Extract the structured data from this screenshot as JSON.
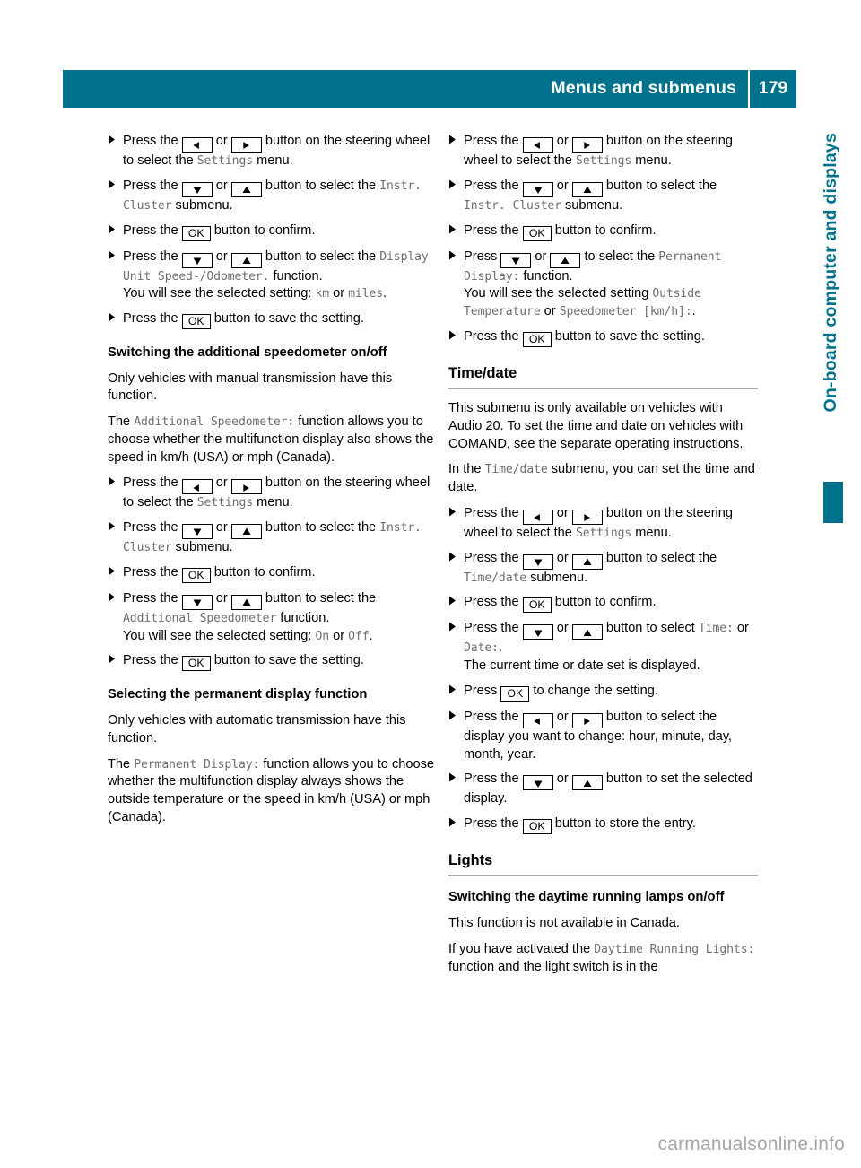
{
  "header": {
    "title": "Menus and submenus",
    "page_number": "179",
    "accent_color": "#00718b"
  },
  "side_tab": {
    "label": "On-board computer and displays",
    "color": "#00718b",
    "bookmark": "chapter-bookmark"
  },
  "watermark": {
    "text": "carmanualsonline.info",
    "color": "#a6a6a6"
  },
  "icons": {
    "bullet": "triangle-right-bullet-icon",
    "left": "arrow-left-icon",
    "right": "arrow-right-icon",
    "up": "arrow-up-icon",
    "down": "arrow-down-icon",
    "ok": "ok-key-icon"
  },
  "keys": {
    "ok_label": "OK"
  },
  "left_column": {
    "steps_display_unit": [
      {
        "parts": [
          {
            "t": "text",
            "v": "Press the "
          },
          {
            "t": "key",
            "v": "left"
          },
          {
            "t": "text",
            "v": " or "
          },
          {
            "t": "key",
            "v": "right"
          },
          {
            "t": "text",
            "v": " button on the steering wheel to select the "
          },
          {
            "t": "ui",
            "v": "Settings"
          },
          {
            "t": "text",
            "v": " menu."
          }
        ]
      },
      {
        "parts": [
          {
            "t": "text",
            "v": "Press the "
          },
          {
            "t": "key",
            "v": "down"
          },
          {
            "t": "text",
            "v": " or "
          },
          {
            "t": "key",
            "v": "up"
          },
          {
            "t": "text",
            "v": " button to select the "
          },
          {
            "t": "ui",
            "v": "Instr. Cluster"
          },
          {
            "t": "bold",
            "v": " submenu."
          }
        ]
      },
      {
        "parts": [
          {
            "t": "text",
            "v": "Press the "
          },
          {
            "t": "key",
            "v": "ok"
          },
          {
            "t": "text",
            "v": " button to confirm."
          }
        ]
      },
      {
        "parts": [
          {
            "t": "text",
            "v": "Press the "
          },
          {
            "t": "key",
            "v": "down"
          },
          {
            "t": "text",
            "v": " or "
          },
          {
            "t": "key",
            "v": "up"
          },
          {
            "t": "text",
            "v": " button to select the "
          },
          {
            "t": "ui",
            "v": "Display Unit Speed-/Odometer."
          },
          {
            "t": "text",
            "v": " function."
          },
          {
            "t": "br",
            "v": ""
          },
          {
            "t": "text",
            "v": "You will see the selected setting: "
          },
          {
            "t": "ui",
            "v": "km"
          },
          {
            "t": "text",
            "v": " or "
          },
          {
            "t": "ui",
            "v": "miles"
          },
          {
            "t": "text",
            "v": "."
          }
        ]
      },
      {
        "parts": [
          {
            "t": "text",
            "v": "Press the "
          },
          {
            "t": "key",
            "v": "ok"
          },
          {
            "t": "text",
            "v": " button to save the setting."
          }
        ]
      }
    ],
    "heading_additional_speedometer": "Switching the additional speedometer on/off",
    "para_manual_transmission": "Only vehicles with manual transmission have this function.",
    "para_additional_speedometer": {
      "parts": [
        {
          "t": "text",
          "v": "The "
        },
        {
          "t": "ui",
          "v": "Additional Speedometer:"
        },
        {
          "t": "text",
          "v": " function allows you to choose whether the multifunction display also shows the speed in km/h (USA) or mph (Canada)."
        }
      ]
    },
    "steps_additional_speedometer": [
      {
        "parts": [
          {
            "t": "text",
            "v": "Press the "
          },
          {
            "t": "key",
            "v": "left"
          },
          {
            "t": "text",
            "v": " or "
          },
          {
            "t": "key",
            "v": "right"
          },
          {
            "t": "text",
            "v": " button on the steering wheel to select the "
          },
          {
            "t": "ui",
            "v": "Settings"
          },
          {
            "t": "text",
            "v": " menu."
          }
        ]
      },
      {
        "parts": [
          {
            "t": "text",
            "v": "Press the "
          },
          {
            "t": "key",
            "v": "down"
          },
          {
            "t": "text",
            "v": " or "
          },
          {
            "t": "key",
            "v": "up"
          },
          {
            "t": "text",
            "v": " button to select the "
          },
          {
            "t": "ui",
            "v": "Instr. Cluster"
          },
          {
            "t": "bold",
            "v": " submenu."
          }
        ]
      },
      {
        "parts": [
          {
            "t": "text",
            "v": "Press the "
          },
          {
            "t": "key",
            "v": "ok"
          },
          {
            "t": "text",
            "v": " button to confirm."
          }
        ]
      },
      {
        "parts": [
          {
            "t": "text",
            "v": "Press the "
          },
          {
            "t": "key",
            "v": "down"
          },
          {
            "t": "text",
            "v": " or "
          },
          {
            "t": "key",
            "v": "up"
          },
          {
            "t": "text",
            "v": " button to select the "
          },
          {
            "t": "ui",
            "v": "Additional Speedometer"
          },
          {
            "t": "bold",
            "v": " function."
          },
          {
            "t": "br",
            "v": ""
          },
          {
            "t": "text",
            "v": "You will see the selected setting: "
          },
          {
            "t": "ui",
            "v": "On"
          },
          {
            "t": "text",
            "v": " or "
          },
          {
            "t": "ui",
            "v": "Off"
          },
          {
            "t": "text",
            "v": "."
          }
        ]
      },
      {
        "parts": [
          {
            "t": "text",
            "v": "Press the "
          },
          {
            "t": "key",
            "v": "ok"
          },
          {
            "t": "text",
            "v": " button to save the setting."
          }
        ]
      }
    ],
    "heading_permanent_display": "Selecting the permanent display function",
    "para_automatic_transmission": "Only vehicles with automatic transmission have this function.",
    "para_permanent_display": {
      "parts": [
        {
          "t": "text",
          "v": "The "
        },
        {
          "t": "ui",
          "v": "Permanent Display:"
        },
        {
          "t": "text",
          "v": " function allows you to choose whether the multifunction display always shows the outside temperature or the speed in km/h (USA) or mph (Canada)."
        }
      ]
    }
  },
  "right_column": {
    "steps_permanent_display": [
      {
        "parts": [
          {
            "t": "text",
            "v": "Press the "
          },
          {
            "t": "key",
            "v": "left"
          },
          {
            "t": "text",
            "v": " or "
          },
          {
            "t": "key",
            "v": "right"
          },
          {
            "t": "text",
            "v": " button on the steering wheel to select the "
          },
          {
            "t": "ui",
            "v": "Settings"
          },
          {
            "t": "text",
            "v": " menu."
          }
        ]
      },
      {
        "parts": [
          {
            "t": "text",
            "v": "Press the "
          },
          {
            "t": "key",
            "v": "down"
          },
          {
            "t": "text",
            "v": " or "
          },
          {
            "t": "key",
            "v": "up"
          },
          {
            "t": "text",
            "v": " button to select the "
          },
          {
            "t": "ui",
            "v": "Instr. Cluster"
          },
          {
            "t": "bold",
            "v": " submenu."
          }
        ]
      },
      {
        "parts": [
          {
            "t": "text",
            "v": "Press the "
          },
          {
            "t": "key",
            "v": "ok"
          },
          {
            "t": "text",
            "v": " button to confirm."
          }
        ]
      },
      {
        "parts": [
          {
            "t": "text",
            "v": "Press "
          },
          {
            "t": "key",
            "v": "down"
          },
          {
            "t": "text",
            "v": " or "
          },
          {
            "t": "key",
            "v": "up"
          },
          {
            "t": "text",
            "v": " to select the "
          },
          {
            "t": "ui",
            "v": "Permanent Display:"
          },
          {
            "t": "text",
            "v": " function."
          },
          {
            "t": "br",
            "v": ""
          },
          {
            "t": "text",
            "v": "You will see the selected setting "
          },
          {
            "t": "ui",
            "v": "Outside Temperature"
          },
          {
            "t": "bold",
            "v": " or "
          },
          {
            "t": "ui",
            "v": "Speedometer [km/h]:"
          },
          {
            "t": "text",
            "v": "."
          }
        ]
      },
      {
        "parts": [
          {
            "t": "text",
            "v": "Press the "
          },
          {
            "t": "key",
            "v": "ok"
          },
          {
            "t": "text",
            "v": " button to save the setting."
          }
        ]
      }
    ],
    "heading_time_date": "Time/date",
    "para_audio20": "This submenu is only available on vehicles with Audio 20. To set the time and date on vehicles with COMAND, see the separate operating instructions.",
    "para_time_date_submenu": {
      "parts": [
        {
          "t": "text",
          "v": "In the "
        },
        {
          "t": "ui",
          "v": "Time/date"
        },
        {
          "t": "bold",
          "v": " submenu,"
        },
        {
          "t": "text",
          "v": " you can set the time and date."
        }
      ]
    },
    "steps_time_date": [
      {
        "parts": [
          {
            "t": "text",
            "v": "Press the "
          },
          {
            "t": "key",
            "v": "left"
          },
          {
            "t": "text",
            "v": " or "
          },
          {
            "t": "key",
            "v": "right"
          },
          {
            "t": "text",
            "v": " button on the steering wheel to select the "
          },
          {
            "t": "ui",
            "v": "Settings"
          },
          {
            "t": "text",
            "v": " menu."
          }
        ]
      },
      {
        "parts": [
          {
            "t": "text",
            "v": "Press the "
          },
          {
            "t": "key",
            "v": "down"
          },
          {
            "t": "text",
            "v": " or "
          },
          {
            "t": "key",
            "v": "up"
          },
          {
            "t": "text",
            "v": " button to select the "
          },
          {
            "t": "ui",
            "v": "Time/date"
          },
          {
            "t": "bold",
            "v": " submenu."
          }
        ]
      },
      {
        "parts": [
          {
            "t": "text",
            "v": "Press the "
          },
          {
            "t": "key",
            "v": "ok"
          },
          {
            "t": "text",
            "v": " button to confirm."
          }
        ]
      },
      {
        "parts": [
          {
            "t": "text",
            "v": "Press the "
          },
          {
            "t": "key",
            "v": "down"
          },
          {
            "t": "text",
            "v": " or "
          },
          {
            "t": "key",
            "v": "up"
          },
          {
            "t": "text",
            "v": " button to select "
          },
          {
            "t": "ui",
            "v": "Time:"
          },
          {
            "t": "bold",
            "v": " or "
          },
          {
            "t": "ui",
            "v": "Date:"
          },
          {
            "t": "text",
            "v": "."
          },
          {
            "t": "br",
            "v": ""
          },
          {
            "t": "text",
            "v": "The current time or date set is displayed."
          }
        ]
      },
      {
        "parts": [
          {
            "t": "text",
            "v": "Press "
          },
          {
            "t": "key",
            "v": "ok"
          },
          {
            "t": "text",
            "v": " to change the setting."
          }
        ]
      },
      {
        "parts": [
          {
            "t": "text",
            "v": "Press the "
          },
          {
            "t": "key",
            "v": "left"
          },
          {
            "t": "text",
            "v": " or "
          },
          {
            "t": "key",
            "v": "right"
          },
          {
            "t": "text",
            "v": " button to select the display you want to change: hour, minute, day, month, year."
          }
        ]
      },
      {
        "parts": [
          {
            "t": "text",
            "v": "Press the "
          },
          {
            "t": "key",
            "v": "down"
          },
          {
            "t": "text",
            "v": " or "
          },
          {
            "t": "key",
            "v": "up"
          },
          {
            "t": "text",
            "v": " button to set the selected display."
          }
        ]
      },
      {
        "parts": [
          {
            "t": "text",
            "v": "Press the "
          },
          {
            "t": "key",
            "v": "ok"
          },
          {
            "t": "text",
            "v": " button to store the entry."
          }
        ]
      }
    ],
    "heading_lights": "Lights",
    "heading_daytime_lamps": "Switching the daytime running lamps on/off",
    "para_not_canada": "This function is not available in Canada.",
    "para_daytime_running": {
      "parts": [
        {
          "t": "text",
          "v": "If you have activated the "
        },
        {
          "t": "ui",
          "v": "Daytime Running Lights:"
        },
        {
          "t": "bold",
          "v": " function and the light switch is in the"
        }
      ]
    }
  }
}
